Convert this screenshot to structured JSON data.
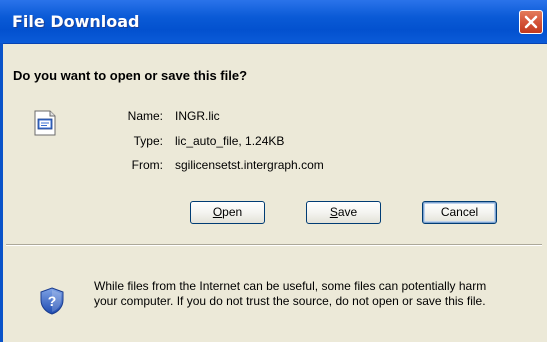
{
  "window": {
    "title": "File Download"
  },
  "dialog": {
    "question": "Do you want to open or save this file?",
    "file": {
      "name_label": "Name:",
      "name_value": "INGR.lic",
      "type_label": "Type:",
      "type_value": "lic_auto_file, 1.24KB",
      "from_label": "From:",
      "from_value": "sgilicensetst.intergraph.com"
    },
    "buttons": {
      "open_prefix": "O",
      "open_rest": "pen",
      "save_prefix": "S",
      "save_rest": "ave",
      "cancel": "Cancel"
    },
    "warning_line1": "While files from the Internet can be useful, some files can potentially harm",
    "warning_line2": "your computer. If you do not trust the source, do not open or save this file."
  },
  "icons": {
    "close": "close-icon",
    "file": "file-icon",
    "shield": "security-shield-icon"
  },
  "colors": {
    "titlebar": "#0a5ad6",
    "close_button": "#d4543a",
    "dialog_bg": "#ece9d8"
  }
}
